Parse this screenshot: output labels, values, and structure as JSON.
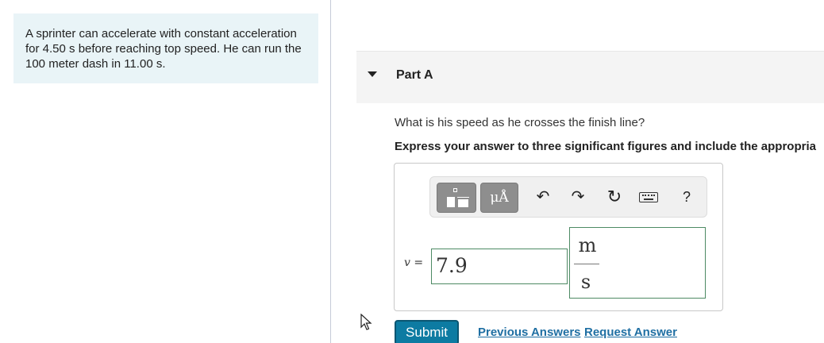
{
  "problem": {
    "text": "A sprinter can accelerate with constant acceleration for 4.50 s before reaching top speed. He can run the 100 meter dash in 11.00 s."
  },
  "part": {
    "title": "Part A",
    "question": "What is his speed as he crosses the finish line?",
    "instruction": "Express your answer to three significant figures and include the appropria"
  },
  "toolbar": {
    "units_label": "μÅ",
    "undo_icon": "↶",
    "redo_icon": "↷",
    "reset_icon": "↻",
    "help_label": "?"
  },
  "answer": {
    "variable": "v",
    "equals": " =",
    "value": "7.9",
    "unit_numerator": "m",
    "unit_denominator": "s"
  },
  "actions": {
    "submit_label": "Submit",
    "previous_answers_label": "Previous Answers",
    "request_answer_label": "Request Answer"
  },
  "colors": {
    "problem_bg": "#e9f4f7",
    "submit_bg": "#0d7ba2",
    "link": "#1f6fa3",
    "input_border": "#4d8a64"
  }
}
